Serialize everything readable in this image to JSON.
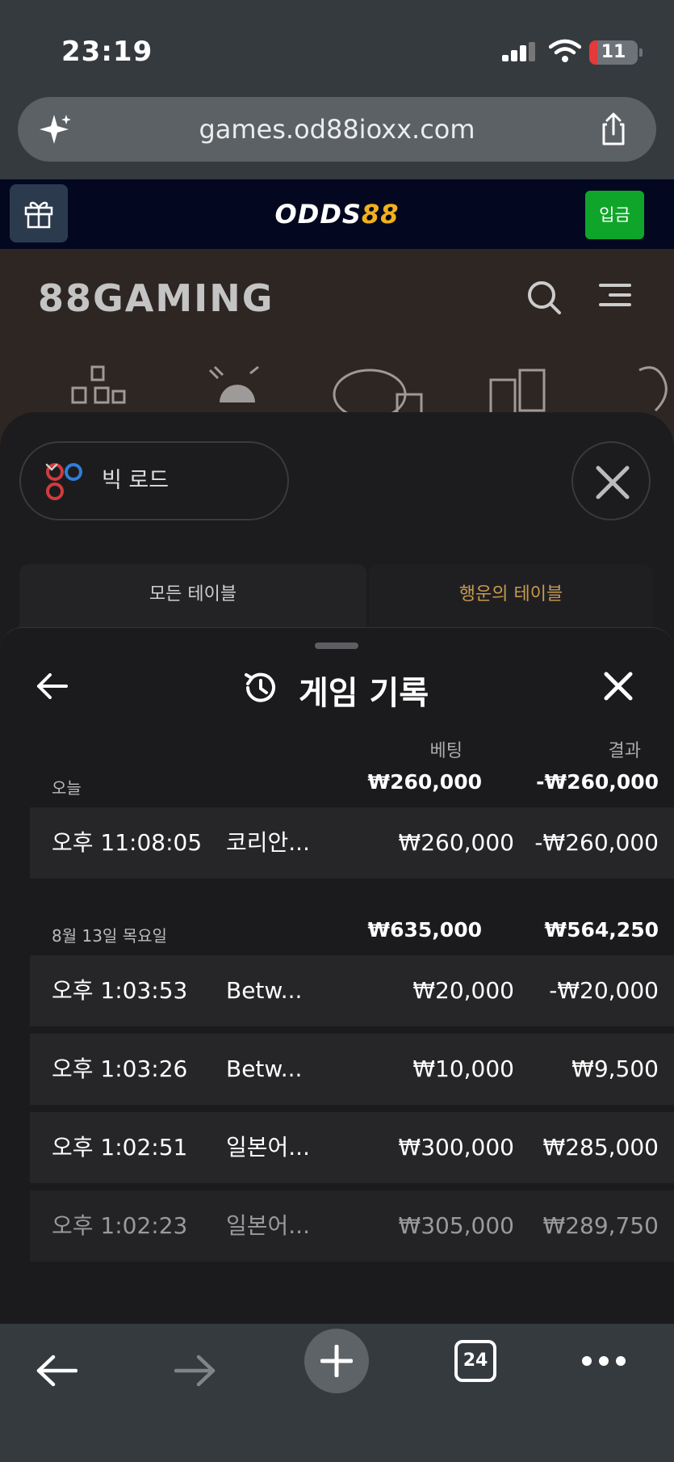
{
  "status_bar": {
    "time": "23:19",
    "battery": "11"
  },
  "browser": {
    "url": "games.od88ioxx.com",
    "tab_count": "24"
  },
  "site_header": {
    "brand_main": "ODDS",
    "brand_accent": "88",
    "deposit_label": "입금"
  },
  "gaming": {
    "logo": "88GAMING"
  },
  "filter": {
    "road_label": "빅 로드",
    "tabs": [
      "모든 테이블",
      "행운의 테이블"
    ]
  },
  "history": {
    "title": "게임 기록",
    "columns": {
      "bet": "베팅",
      "result": "결과"
    },
    "groups": [
      {
        "label": "오늘",
        "total_bet": "₩260,000",
        "total_result": "-₩260,000",
        "rows": [
          {
            "time": "오후 11:08:05",
            "game": "코리안...",
            "bet": "₩260,000",
            "result": "-₩260,000"
          }
        ]
      },
      {
        "label": "8월 13일 목요일",
        "total_bet": "₩635,000",
        "total_result": "₩564,250",
        "rows": [
          {
            "time": "오후 1:03:53",
            "game": "Betw...",
            "bet": "₩20,000",
            "result": "-₩20,000"
          },
          {
            "time": "오후 1:03:26",
            "game": "Betw...",
            "bet": "₩10,000",
            "result": "₩9,500"
          },
          {
            "time": "오후 1:02:51",
            "game": "일본어...",
            "bet": "₩300,000",
            "result": "₩285,000"
          },
          {
            "time": "오후 1:02:23",
            "game": "일본어...",
            "bet": "₩305,000",
            "result": "₩289,750"
          }
        ]
      }
    ]
  },
  "colors": {
    "brand_accent": "#f1b11b",
    "deposit_green": "#0fa52a",
    "lucky_tab": "#c79a4e"
  }
}
